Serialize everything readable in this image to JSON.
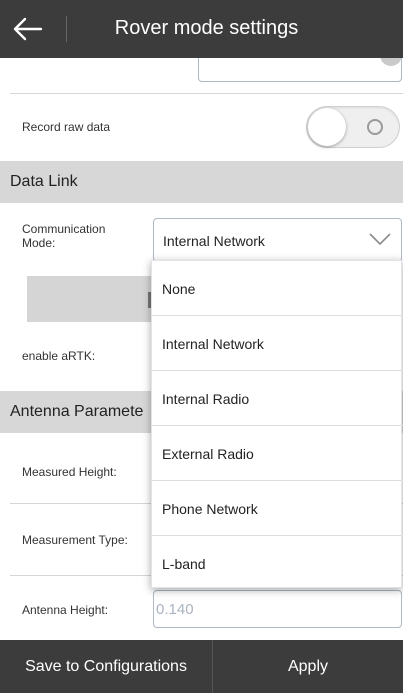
{
  "header": {
    "title": "Rover mode settings"
  },
  "record_raw_data": {
    "label": "Record raw data"
  },
  "data_link_section": {
    "title": "Data Link"
  },
  "communication_mode": {
    "label": "Communication Mode:",
    "value": "Internal Network"
  },
  "enable_artk": {
    "label": "enable aRTK:"
  },
  "antenna_section": {
    "title": "Antenna Paramete"
  },
  "measured_height": {
    "label": "Measured Height:"
  },
  "measurement_type": {
    "label": "Measurement Type:"
  },
  "antenna_height": {
    "label": "Antenna Height:",
    "value": "0.140"
  },
  "dropdown": {
    "options": [
      "None",
      "Internal Network",
      "Internal Radio",
      "External Radio",
      "Phone Network",
      "L-band"
    ]
  },
  "footer": {
    "save_label": "Save to Configurations",
    "apply_label": "Apply"
  },
  "colors": {
    "bar": "#3c3c3c",
    "section": "#d7d7d7",
    "input_border": "#aeb9c6"
  }
}
